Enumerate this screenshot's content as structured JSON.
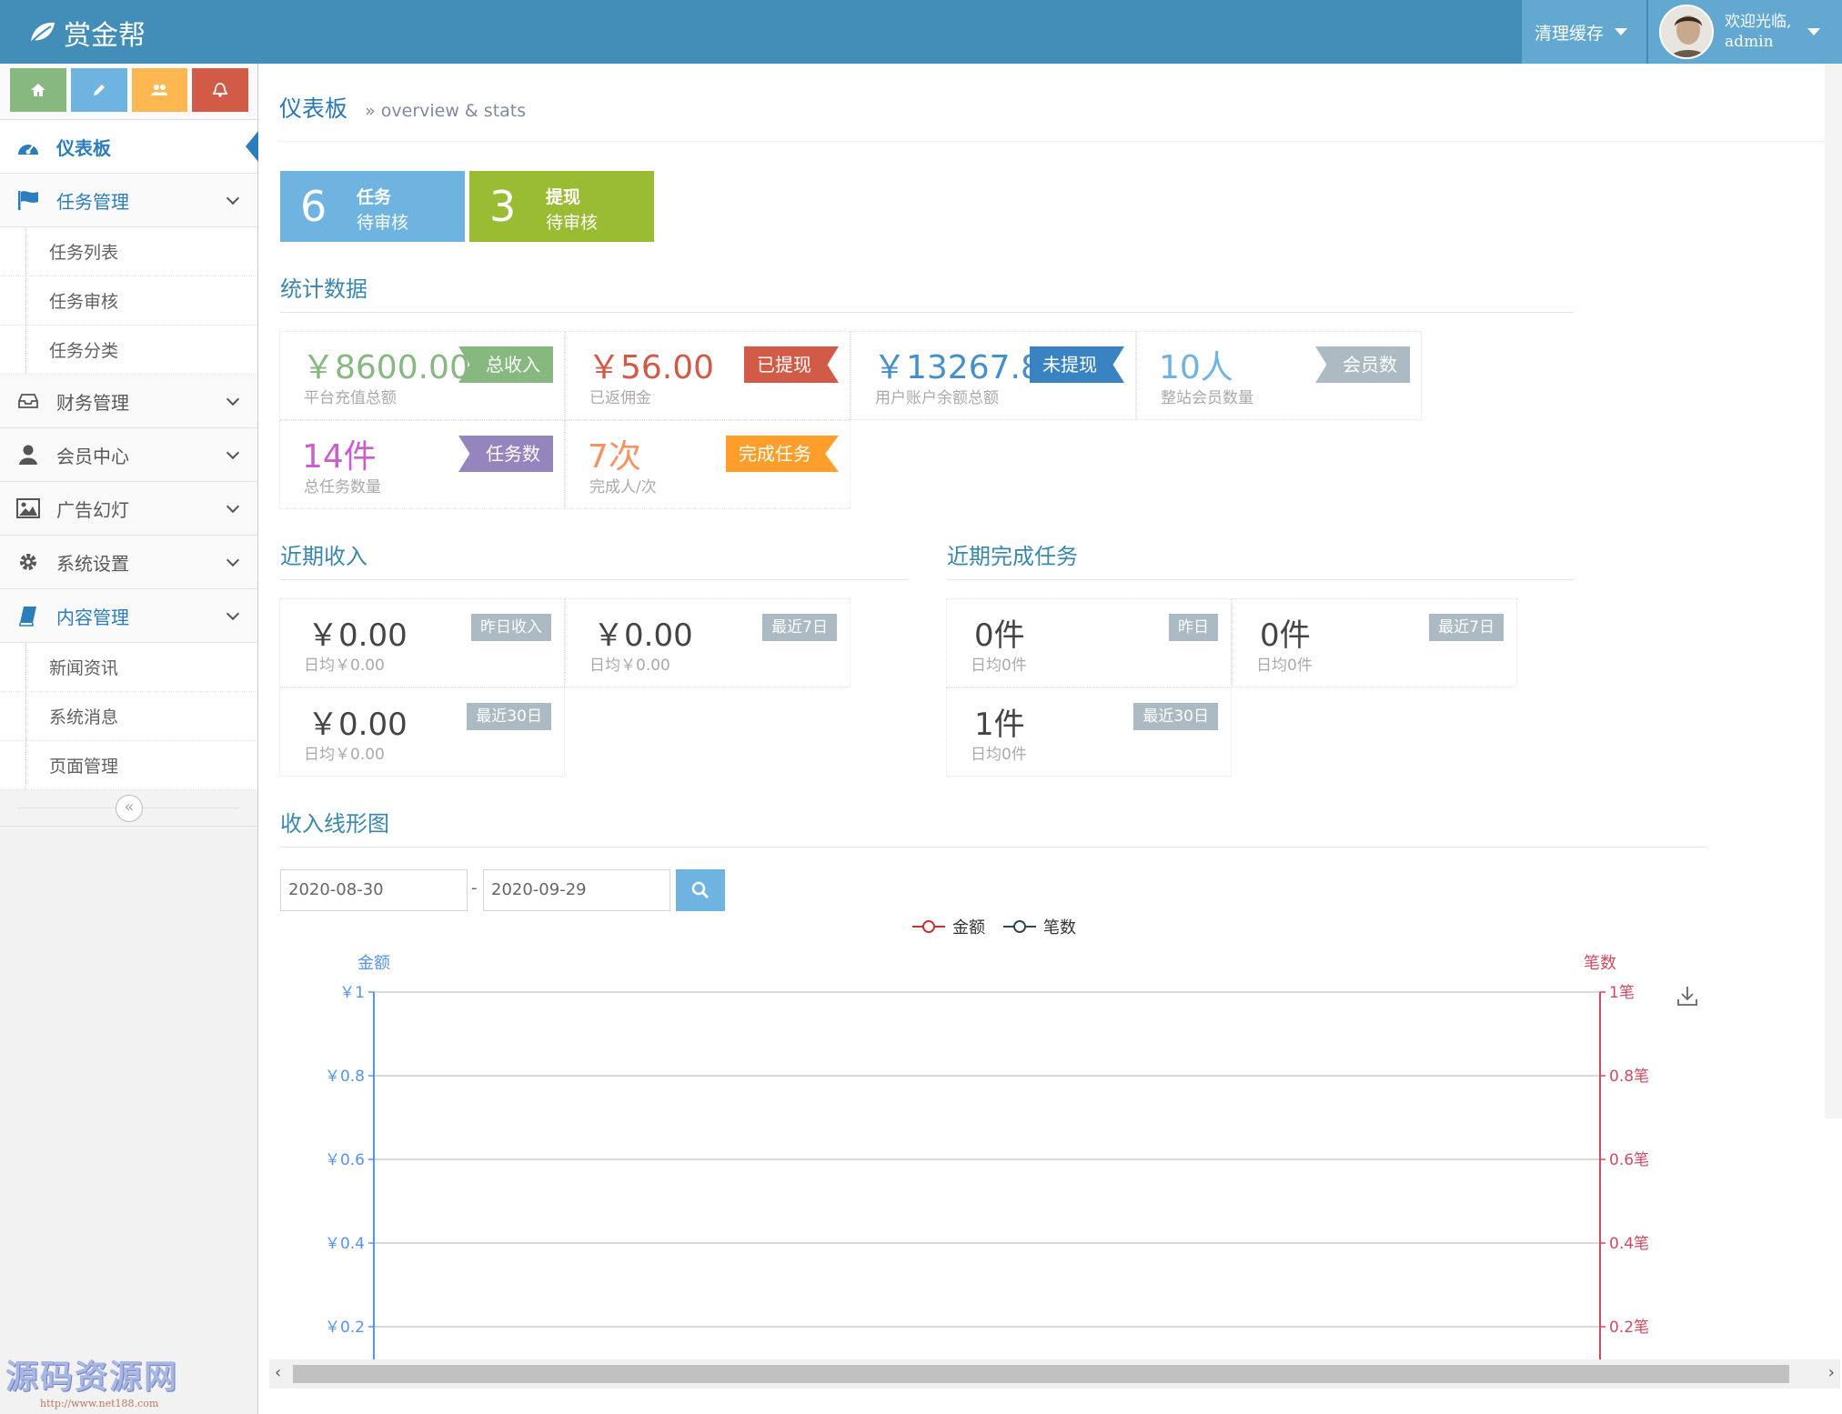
{
  "brand": {
    "name": "赏金帮"
  },
  "navbar": {
    "cache_label": "清理缓存",
    "welcome": "欢迎光临,",
    "user": "admin"
  },
  "sidebar": {
    "shortcut_colors": [
      "#87b87f",
      "#6fb3e0",
      "#ffb752",
      "#d15b47"
    ],
    "items": [
      {
        "label": "仪表板"
      },
      {
        "label": "任务管理",
        "sub": [
          "任务列表",
          "任务审核",
          "任务分类"
        ]
      },
      {
        "label": "财务管理"
      },
      {
        "label": "会员中心"
      },
      {
        "label": "广告幻灯"
      },
      {
        "label": "系统设置"
      },
      {
        "label": "内容管理",
        "sub": [
          "新闻资讯",
          "系统消息",
          "页面管理"
        ]
      }
    ]
  },
  "header": {
    "title": "仪表板",
    "subtitle": "» overview & stats"
  },
  "infoboxes": [
    {
      "num": "6",
      "t1": "任务",
      "t2": "待审核",
      "color": "#6fb3e0"
    },
    {
      "num": "3",
      "t1": "提现",
      "t2": "待审核",
      "color": "#9abc32"
    }
  ],
  "stats": {
    "title": "统计数据",
    "boxes": [
      {
        "value": "￥8600.00",
        "label": "平台充值总额",
        "tag": "总收入",
        "vcolor": "#87b87f",
        "tcolor": "#87b87f"
      },
      {
        "value": "￥56.00",
        "label": "已返佣金",
        "tag": "已提现",
        "vcolor": "#d15b47",
        "tcolor": "#d15b47"
      },
      {
        "value": "￥13267.84",
        "label": "用户账户余额总额",
        "tag": "未提现",
        "vcolor": "#478fca",
        "tcolor": "#3983c2"
      },
      {
        "value": "10人",
        "label": "整站会员数量",
        "tag": "会员数",
        "vcolor": "#6fb3e0",
        "tcolor": "#abbac3"
      },
      {
        "value": "14件",
        "label": "总任务数量",
        "tag": "任务数",
        "vcolor": "#c95fcb",
        "tcolor": "#9585bf"
      },
      {
        "value": "7次",
        "label": "完成人/次",
        "tag": "完成任务",
        "vcolor": "#f79263",
        "tcolor": "#ff9e2a"
      }
    ]
  },
  "income": {
    "title": "近期收入",
    "boxes": [
      {
        "value": "￥0.00",
        "label": "日均￥0.00",
        "tag": "昨日收入"
      },
      {
        "value": "￥0.00",
        "label": "日均￥0.00",
        "tag": "最近7日"
      },
      {
        "value": "￥0.00",
        "label": "日均￥0.00",
        "tag": "最近30日"
      }
    ]
  },
  "tasks": {
    "title": "近期完成任务",
    "boxes": [
      {
        "value": "0件",
        "label": "日均0件",
        "tag": "昨日"
      },
      {
        "value": "0件",
        "label": "日均0件",
        "tag": "最近7日"
      },
      {
        "value": "1件",
        "label": "日均0件",
        "tag": "最近30日"
      }
    ]
  },
  "chart_section": {
    "title": "收入线形图",
    "date_from": "2020-08-30",
    "date_sep": "-",
    "date_to": "2020-09-29"
  },
  "chart_data": {
    "type": "line",
    "title": "",
    "series": [
      {
        "name": "金额",
        "color": "#c23531",
        "values": []
      },
      {
        "name": "笔数",
        "color": "#2f4554",
        "values": []
      }
    ],
    "y_left": {
      "label": "金额",
      "ticks": [
        "￥1",
        "￥0.8",
        "￥0.6",
        "￥0.4",
        "￥0.2"
      ],
      "tick_values": [
        1,
        0.8,
        0.6,
        0.4,
        0.2
      ],
      "range": [
        0,
        1
      ],
      "color": "#5793f3"
    },
    "y_right": {
      "label": "笔数",
      "ticks": [
        "1笔",
        "0.8笔",
        "0.6笔",
        "0.4笔",
        "0.2笔"
      ],
      "tick_values": [
        1,
        0.8,
        0.6,
        0.4,
        0.2
      ],
      "range": [
        0,
        1
      ],
      "color": "#d14a61"
    },
    "grid": true,
    "legend": "top-center"
  },
  "watermark": {
    "title": "源码资源网",
    "url": "http://www.net188.com"
  }
}
